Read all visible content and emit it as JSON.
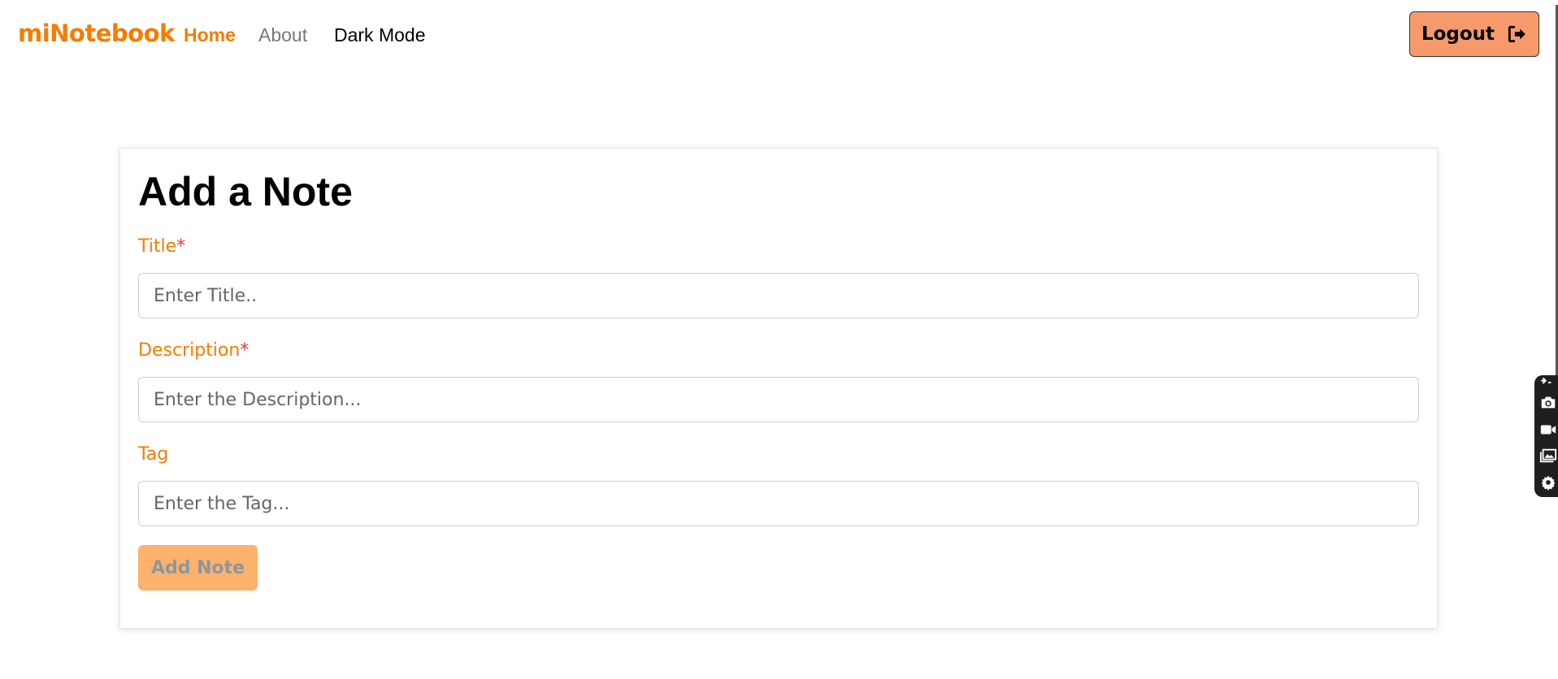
{
  "navbar": {
    "brand": "miNotebook",
    "links": [
      {
        "label": "Home"
      },
      {
        "label": "About"
      },
      {
        "label": "Dark Mode"
      }
    ],
    "logout_label": "Logout"
  },
  "form": {
    "title": "Add a Note",
    "fields": [
      {
        "label": "Title",
        "required_mark": "*",
        "placeholder": "Enter Title.."
      },
      {
        "label": "Description",
        "required_mark": "*",
        "placeholder": "Enter the Description..."
      },
      {
        "label": "Tag",
        "required_mark": "",
        "placeholder": "Enter the Tag..."
      }
    ],
    "submit_label": "Add Note"
  },
  "side_toolbar": {
    "icons": [
      "pin-icon",
      "camera-icon",
      "video-icon",
      "gallery-icon",
      "settings-icon"
    ]
  },
  "colors": {
    "accent": "#f57c00",
    "logout_bg": "#f79a6b",
    "submit_bg": "#ffb26b",
    "required": "#e53935"
  }
}
